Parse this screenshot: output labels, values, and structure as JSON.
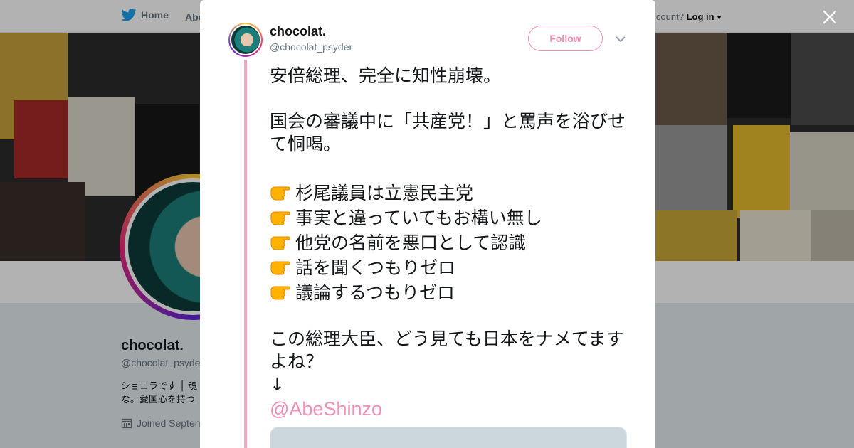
{
  "topbar": {
    "home_label": "Home",
    "about_label": "Abo",
    "account_prompt": "count?",
    "login_label": "Log in"
  },
  "profile_background": {
    "name": "chocolat.",
    "handle": "@chocolat_psyde",
    "bio_line1": "ショコラです │ 魂",
    "bio_line2": "な。愛国心を持つ",
    "joined": "Joined Septen"
  },
  "tweet": {
    "author_name": "chocolat.",
    "author_handle": "@chocolat_psyder",
    "follow_label": "Follow",
    "line1": "安倍総理、完全に知性崩壊。",
    "para2": "国会の審議中に「共産党！」と罵声を浴びせて恫喝。",
    "bullets": [
      "杉尾議員は立憲民主党",
      "事実と違っていてもお構い無し",
      "他党の名前を悪口として認識",
      "話を聞くつもりゼロ",
      "議論するつもりゼロ"
    ],
    "closing": "この総理大臣、どう見ても日本をナメてますよね？",
    "arrow": "↓",
    "mention": "@AbeShinzo"
  },
  "colors": {
    "accent_pink": "#f28fb5",
    "thread_line": "#f7a8c4",
    "twitter_blue": "#1da1f2"
  },
  "icons": {
    "bird": "twitter-bird-icon",
    "close": "close-icon",
    "caret": "chevron-down-icon",
    "calendar": "calendar-icon",
    "pointing": "backhand-index-pointing-right-emoji"
  }
}
